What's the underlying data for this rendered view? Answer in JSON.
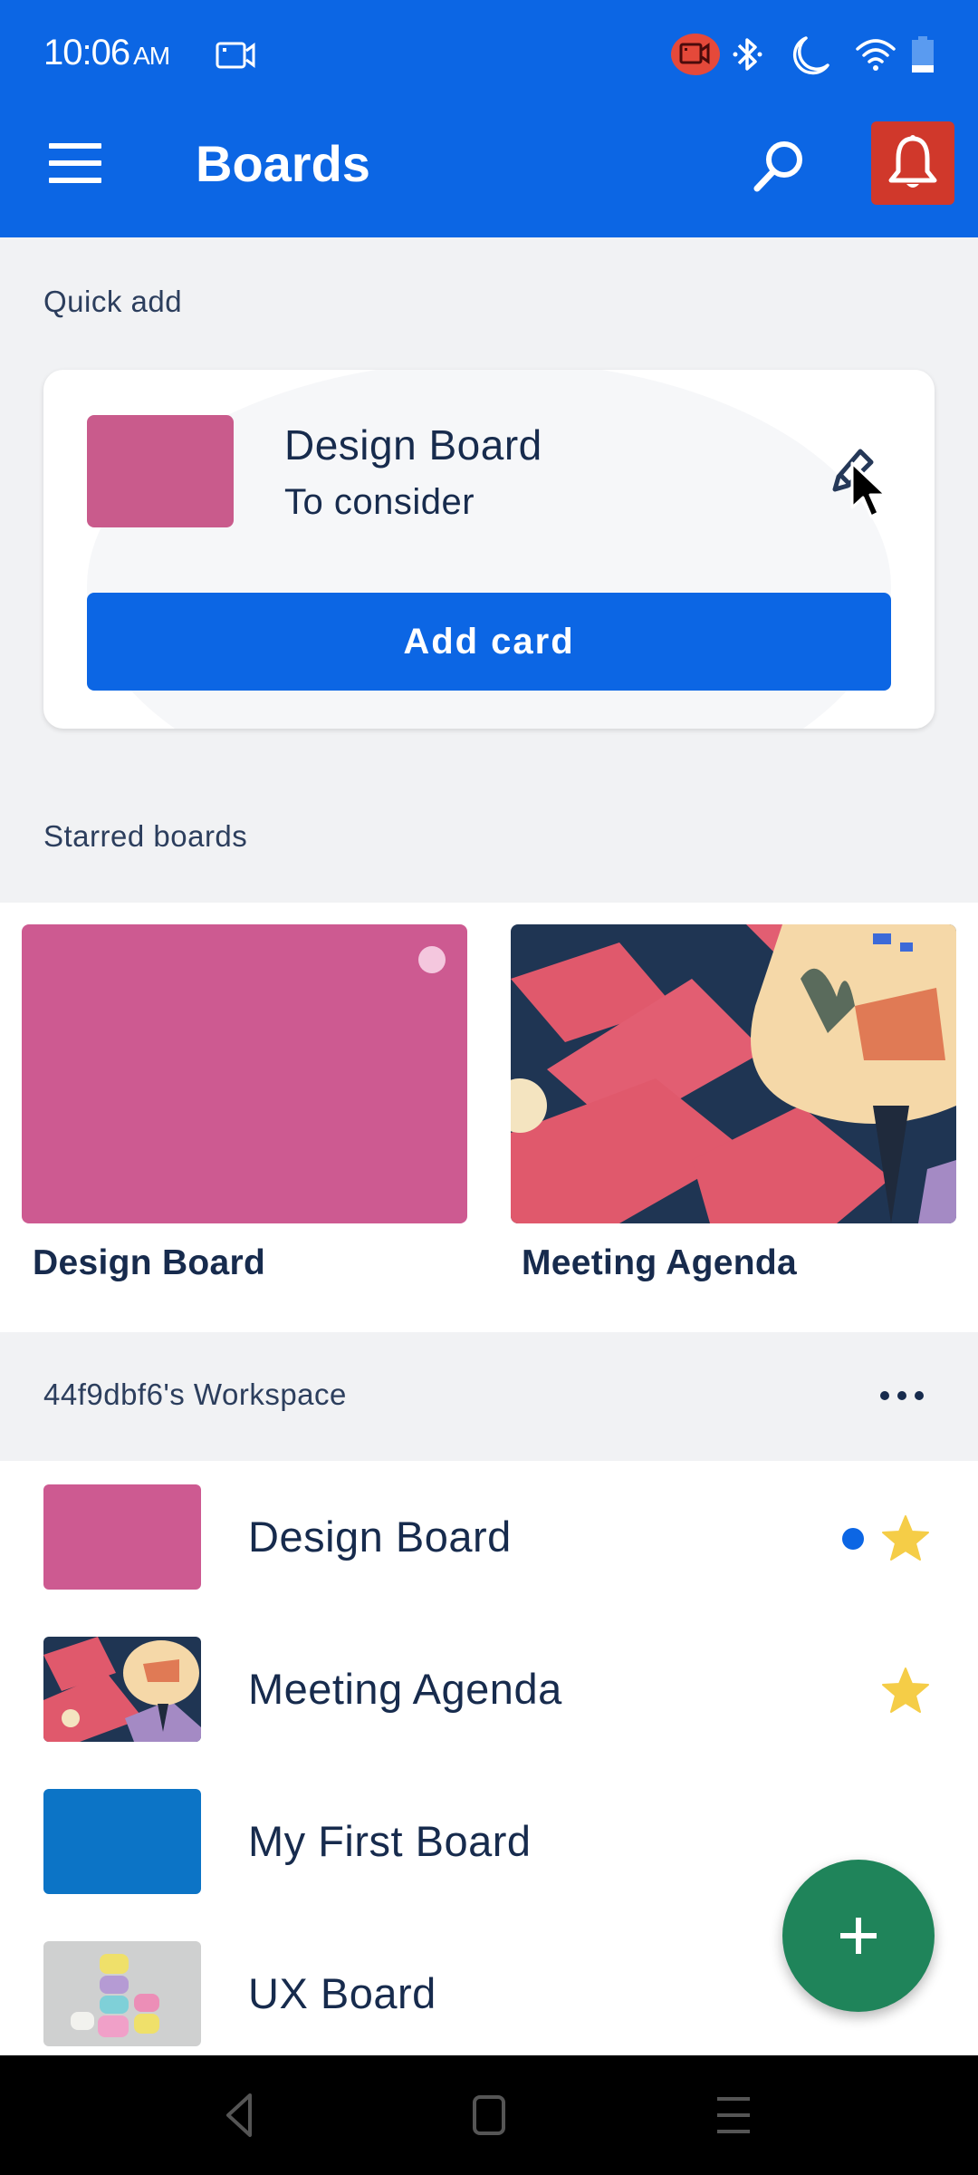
{
  "status_bar": {
    "time": "10:06",
    "ampm": "AM",
    "icons": [
      "screen-record-icon",
      "recording-active-icon",
      "bluetooth-icon",
      "do-not-disturb-moon-icon",
      "wifi-icon",
      "battery-icon"
    ]
  },
  "app_bar": {
    "title": "Boards",
    "menu_icon": "hamburger-menu-icon",
    "search_icon": "search-icon",
    "notifications_icon": "bell-icon",
    "notifications_bg": "#d0382b"
  },
  "colors": {
    "brand_blue": "#0c66e4",
    "pink": "#cd5a91",
    "board_blue": "#0c74c6",
    "fab_green": "#1f845a",
    "star_yellow": "#f5cd47"
  },
  "quick_add": {
    "section_label": "Quick add",
    "board_name": "Design Board",
    "list_name": "To consider",
    "thumb_color": "#c95b8c",
    "edit_icon": "pencil-icon",
    "button_label": "Add card"
  },
  "starred": {
    "section_label": "Starred boards",
    "boards": [
      {
        "name": "Design Board",
        "background": "pink-solid",
        "has_unread": true
      },
      {
        "name": "Meeting Agenda",
        "background": "illustration-image"
      }
    ]
  },
  "workspace": {
    "title": "44f9dbf6's Workspace",
    "more_icon": "more-horizontal-icon",
    "boards": [
      {
        "name": "Design Board",
        "thumb": "pink-solid",
        "unread": true,
        "starred": true
      },
      {
        "name": "Meeting Agenda",
        "thumb": "illustration-image",
        "unread": false,
        "starred": true
      },
      {
        "name": "My First Board",
        "thumb": "blue-solid",
        "unread": false,
        "starred": false
      },
      {
        "name": "UX Board",
        "thumb": "macarons-photo",
        "unread": false,
        "starred": false
      }
    ]
  },
  "fab": {
    "icon": "plus-icon",
    "label": "Create"
  },
  "nav_bar": {
    "back": "back-icon",
    "home": "home-icon",
    "recents": "recents-icon"
  }
}
